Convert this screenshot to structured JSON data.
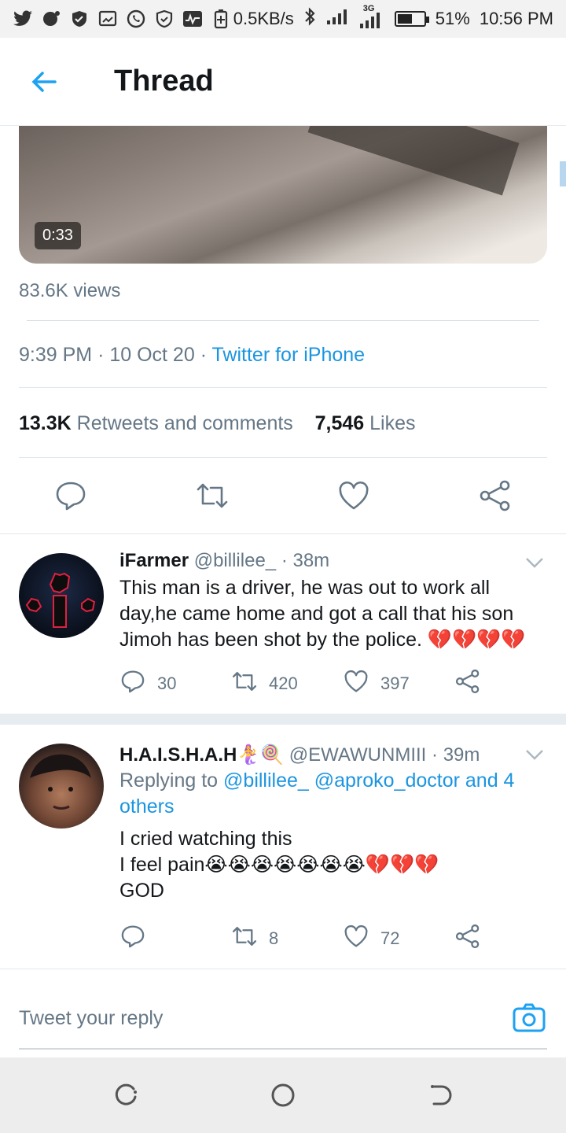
{
  "status_bar": {
    "net_speed": "0.5KB/s",
    "battery": "51%",
    "battery_level": 0.51,
    "time": "10:56 PM",
    "signal_label": "3G"
  },
  "header": {
    "title": "Thread"
  },
  "tweet": {
    "video_duration": "0:33",
    "views": "83.6K views",
    "time": "9:39 PM",
    "date": "10 Oct 20",
    "source": "Twitter for iPhone",
    "retweets_count": "13.3K",
    "retweets_label": "Retweets and comments",
    "likes_count": "7,546",
    "likes_label": "Likes"
  },
  "replies": [
    {
      "name": "iFarmer",
      "handle": "@billilee_",
      "time": "38m",
      "text": "This man is a driver, he was out to work all day,he came home and got a call that his son Jimoh has been shot by the police. 💔💔💔💔",
      "reply_count": "30",
      "retweet_count": "420",
      "like_count": "397"
    },
    {
      "name": "H.A.I.S.H.A.H🧜‍♀️🍭",
      "handle": "@EWAWUNMIII",
      "time": "39m",
      "replying_prefix": "Replying to",
      "replying_links": "@billilee_ @aproko_doctor and 4 others",
      "text_lines": [
        "I cried watching this",
        "I feel pain😭😭😭😭😭😭😭💔💔💔",
        "GOD"
      ],
      "retweet_count": "8",
      "like_count": "72"
    }
  ],
  "compose": {
    "placeholder": "Tweet your reply"
  },
  "colors": {
    "accent": "#1b95e0",
    "muted": "#657786"
  }
}
